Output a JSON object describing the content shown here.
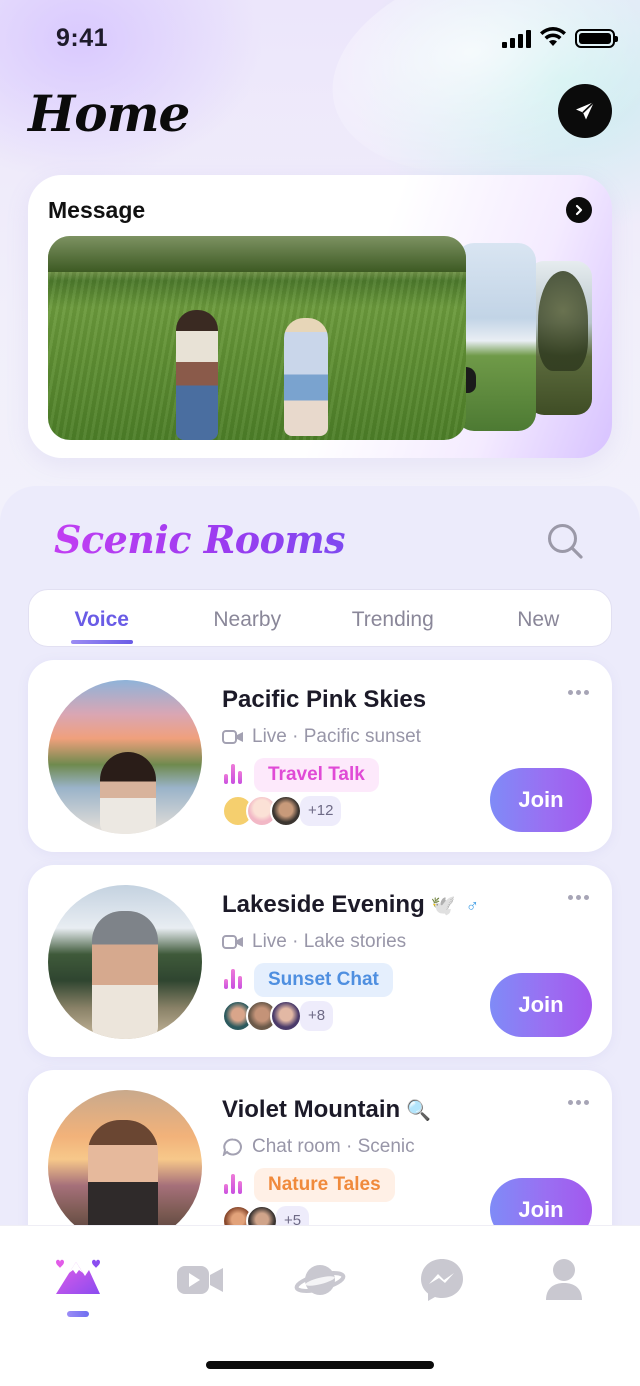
{
  "status_bar": {
    "time": "9:41"
  },
  "header": {
    "title": "Home"
  },
  "message_card": {
    "title": "Message"
  },
  "rooms_section": {
    "title": "Scenic Rooms",
    "tabs": [
      {
        "label": "Voice",
        "active": true
      },
      {
        "label": "Nearby",
        "active": false
      },
      {
        "label": "Trending",
        "active": false
      },
      {
        "label": "New",
        "active": false
      }
    ]
  },
  "rooms": [
    {
      "name": "Pacific Pink Skies",
      "emoji": "",
      "gender": "",
      "subtitle": "Live · Pacific sunset",
      "subtitle_icon": "video-icon",
      "tag": "Travel Talk",
      "tag_color": "#e04ad6",
      "more_count": "+12",
      "join_label": "Join"
    },
    {
      "name": "Lakeside Evening",
      "emoji": "🕊️",
      "gender": "♂",
      "subtitle": "Live · Lake stories",
      "subtitle_icon": "video-icon",
      "tag": "Sunset Chat",
      "tag_color": "#4f8fe0",
      "more_count": "+8",
      "join_label": "Join"
    },
    {
      "name": "Violet Mountain",
      "emoji": "🔍",
      "gender": "",
      "subtitle": "Chat room · Scenic",
      "subtitle_icon": "chat-bubble-icon",
      "tag": "Nature Tales",
      "tag_color": "#f08a3c",
      "more_count": "+5",
      "join_label": "Join"
    }
  ],
  "bottom_nav": {
    "items": [
      "mountain-home-icon",
      "video-camera-icon",
      "planet-icon",
      "messenger-icon",
      "profile-icon"
    ],
    "active_index": 0
  },
  "colors": {
    "accent_purple": "#6a5ce6",
    "title_gradient_start": "#c23ef2",
    "join_gradient_start": "#7f8bf7",
    "join_gradient_end": "#a258ee"
  }
}
